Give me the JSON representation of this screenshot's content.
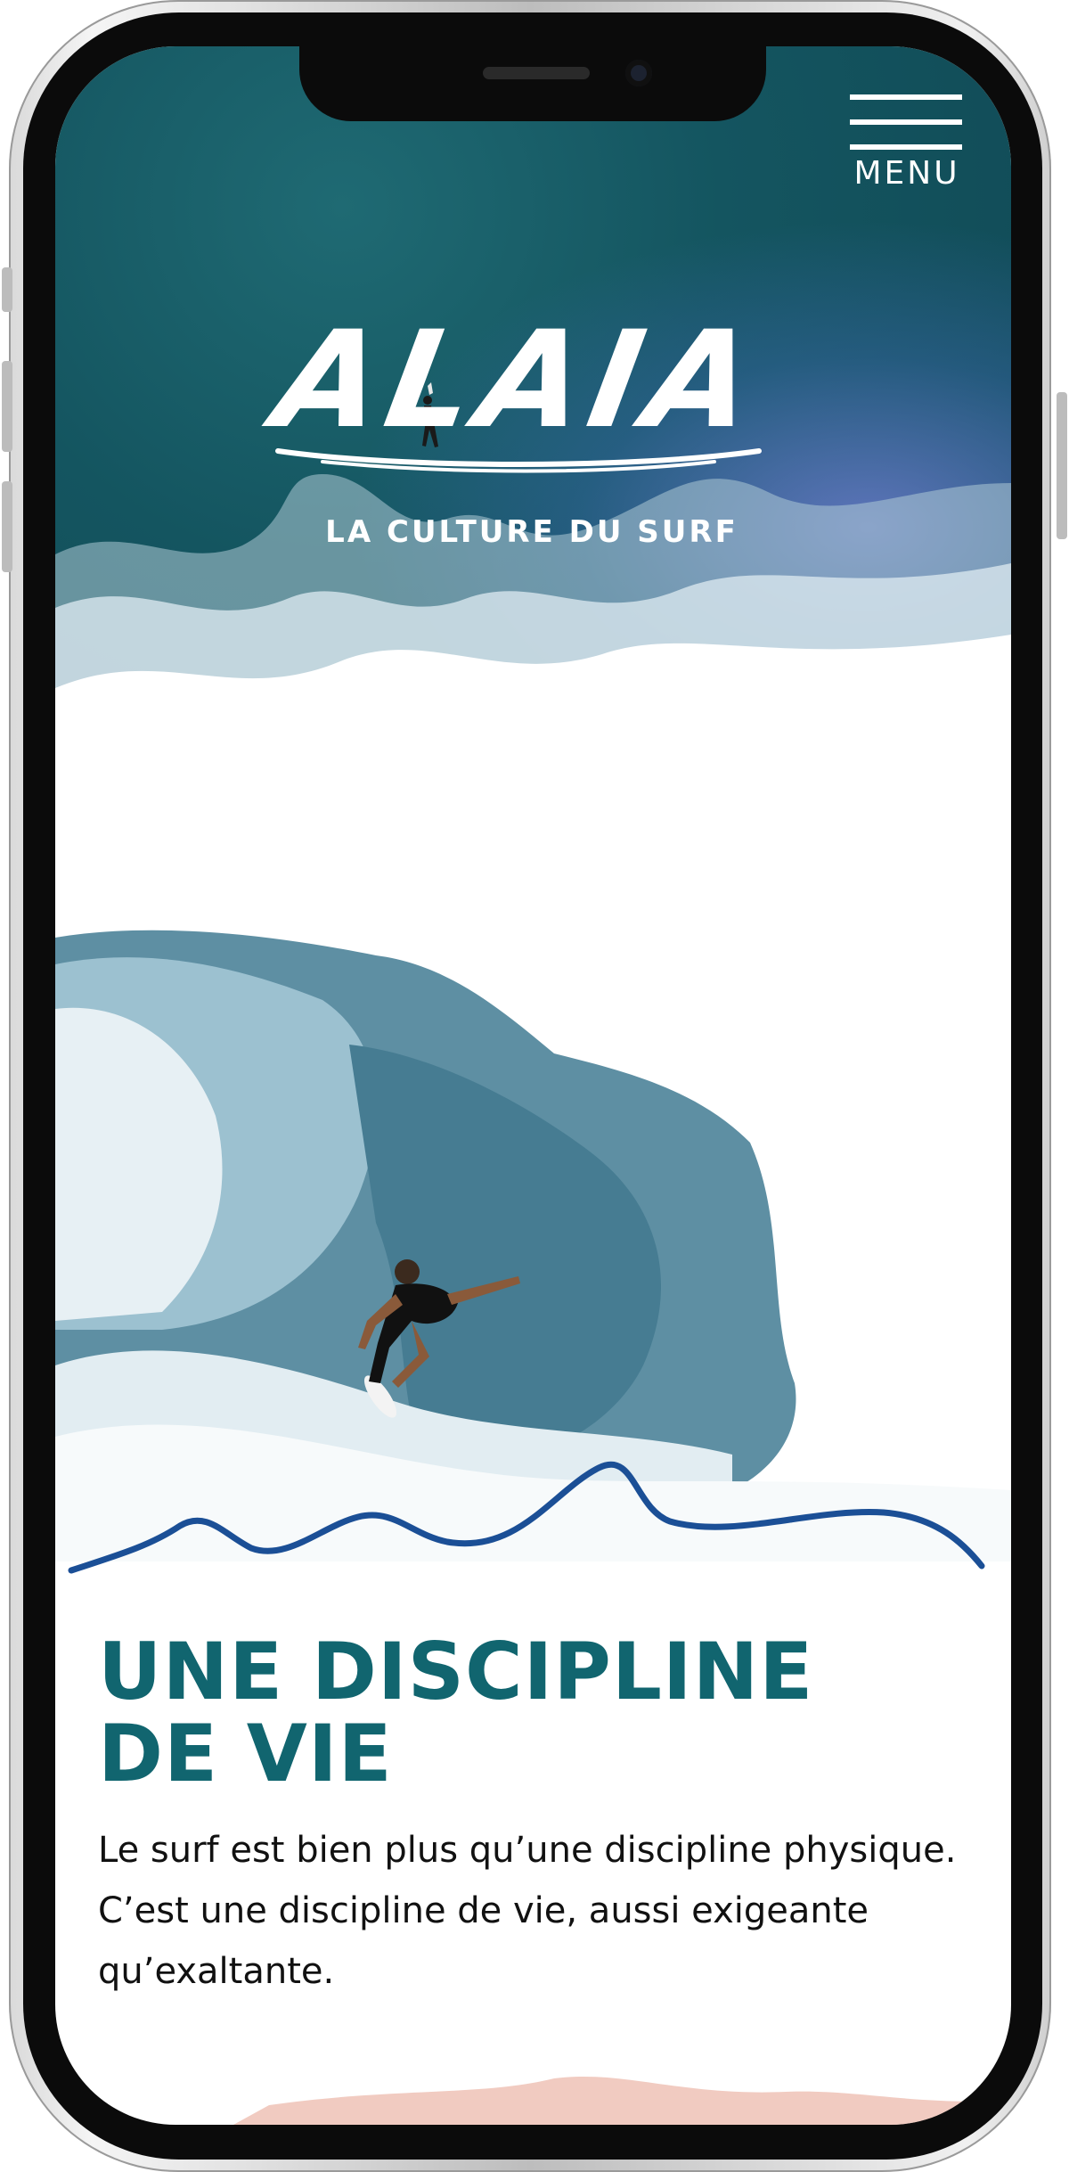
{
  "header": {
    "menu_label": "MENU"
  },
  "hero": {
    "logo_text": "ALAIA",
    "tagline": "LA CULTURE DU SURF"
  },
  "content": {
    "headline_line1": "UNE DISCIPLINE",
    "headline_line2": "DE VIE",
    "body": "Le surf est bien plus qu’une discipline physique. C’est une discipline de vie, aussi exigeante qu’exaltante."
  },
  "colors": {
    "ocean_teal": "#145560",
    "headline": "#11656f",
    "wave_line": "#1b4f96",
    "text": "#111111"
  }
}
